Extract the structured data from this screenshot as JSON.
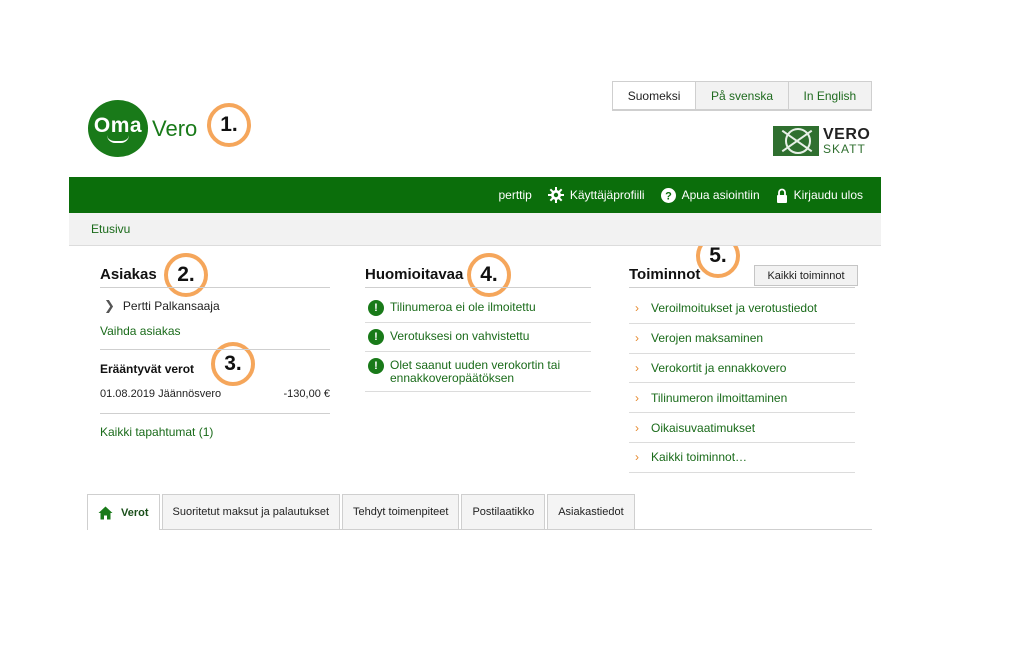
{
  "languages": [
    "Suomeksi",
    "På svenska",
    "In English"
  ],
  "logo": {
    "oma": "Oma",
    "vero": "Vero"
  },
  "skatt_logo": {
    "line1": "VERO",
    "line2": "SKATT"
  },
  "badges": [
    "1.",
    "2.",
    "3.",
    "4.",
    "5."
  ],
  "topnav": {
    "user": "perttip",
    "profile": "Käyttäjäprofiili",
    "help": "Apua asiointiin",
    "logout": "Kirjaudu ulos"
  },
  "breadcrumb": "Etusivu",
  "customer": {
    "title": "Asiakas",
    "name": "Pertti Palkansaaja",
    "switch_link": "Vaihda asiakas",
    "due_title": "Erääntyvät verot",
    "due_date_type": "01.08.2019 Jäännösvero",
    "due_amount": "-130,00 €",
    "all_events": "Kaikki tapahtumat (1)"
  },
  "notices": {
    "title": "Huomioitavaa",
    "items": [
      "Tilinumeroa ei ole ilmoitettu",
      "Verotuksesi on vahvistettu",
      "Olet saanut uuden verokortin tai ennakkoveropäätöksen"
    ]
  },
  "actions": {
    "title": "Toiminnot",
    "all_button": "Kaikki toiminnot",
    "items": [
      "Veroilmoitukset ja verotustiedot",
      "Verojen maksaminen",
      "Verokortit ja ennakkovero",
      "Tilinumeron ilmoittaminen",
      "Oikaisuvaatimukset",
      "Kaikki toiminnot…"
    ]
  },
  "tabs": [
    "Verot",
    "Suoritetut maksut ja palautukset",
    "Tehdyt toimenpiteet",
    "Postilaatikko",
    "Asiakastiedot"
  ],
  "colors": {
    "brand_green": "#0b6e0b",
    "badge_orange": "#f5a65b",
    "arrow_orange": "#e68a2e"
  }
}
